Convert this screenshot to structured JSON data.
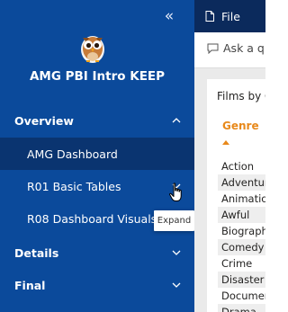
{
  "nav": {
    "title": "AMG PBI Intro KEEP",
    "sections": [
      {
        "label": "Overview",
        "expanded": true,
        "pages": [
          {
            "label": "AMG Dashboard",
            "selected": true
          },
          {
            "label": "R01 Basic Tables",
            "selected": false
          },
          {
            "label": "R08 Dashboard Visuals",
            "selected": false
          }
        ]
      },
      {
        "label": "Details",
        "expanded": false
      },
      {
        "label": "Final",
        "expanded": false
      }
    ],
    "tooltip": "Expand"
  },
  "toolbar": {
    "file_label": "File"
  },
  "report": {
    "qna_placeholder": "Ask a q",
    "visual_title": "Films by G",
    "table_header": "Genre",
    "genres": [
      "Action",
      "Adventure",
      "Animation",
      "Awful",
      "Biography",
      "Comedy",
      "Crime",
      "Disaster",
      "Documentary",
      "Drama"
    ]
  },
  "colors": {
    "nav_bg": "#0b4a9b",
    "nav_selected": "#0a3470",
    "topbar": "#0b2a5c",
    "header_accent": "#e8891b"
  }
}
